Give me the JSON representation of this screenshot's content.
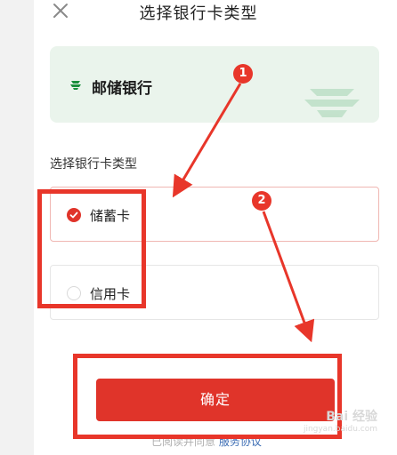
{
  "header": {
    "title": "选择银行卡类型"
  },
  "bank": {
    "name": "邮储银行"
  },
  "section": {
    "label": "选择银行卡类型"
  },
  "options": [
    {
      "label": "储蓄卡",
      "selected": true
    },
    {
      "label": "信用卡",
      "selected": false
    }
  ],
  "actions": {
    "confirm_label": "确定"
  },
  "agreement": {
    "prefix": "已阅读并同意",
    "link_text": "服务协议"
  },
  "annotations": {
    "step_1": "1",
    "step_2": "2"
  },
  "watermark": {
    "brand": "Bai 经验",
    "sub": "jingyan.baidu.com"
  },
  "colors": {
    "accent": "#e0342a",
    "bank_card_bg": "#eaf4ec",
    "bank_logo": "#1a8f3c",
    "link": "#3f6fb5"
  }
}
